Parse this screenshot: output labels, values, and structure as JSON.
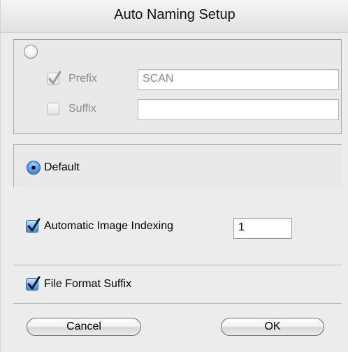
{
  "window": {
    "title": "Auto Naming Setup"
  },
  "custom_group": {
    "radio_selected": false,
    "prefix": {
      "label": "Prefix",
      "checked": true,
      "value": "SCAN"
    },
    "suffix": {
      "label": "Suffix",
      "checked": false,
      "value": ""
    }
  },
  "default_option": {
    "label": "Default",
    "selected": true
  },
  "indexing": {
    "label": "Automatic Image Indexing",
    "checked": true,
    "value": "1"
  },
  "file_format": {
    "label": "File Format Suffix",
    "checked": true
  },
  "buttons": {
    "cancel": "Cancel",
    "ok": "OK"
  },
  "colors": {
    "accent": "#3f86dd",
    "dialog_bg": "#ececec"
  },
  "icons": {
    "check": "checkmark-icon",
    "radio_dot": "radio-dot-icon"
  }
}
